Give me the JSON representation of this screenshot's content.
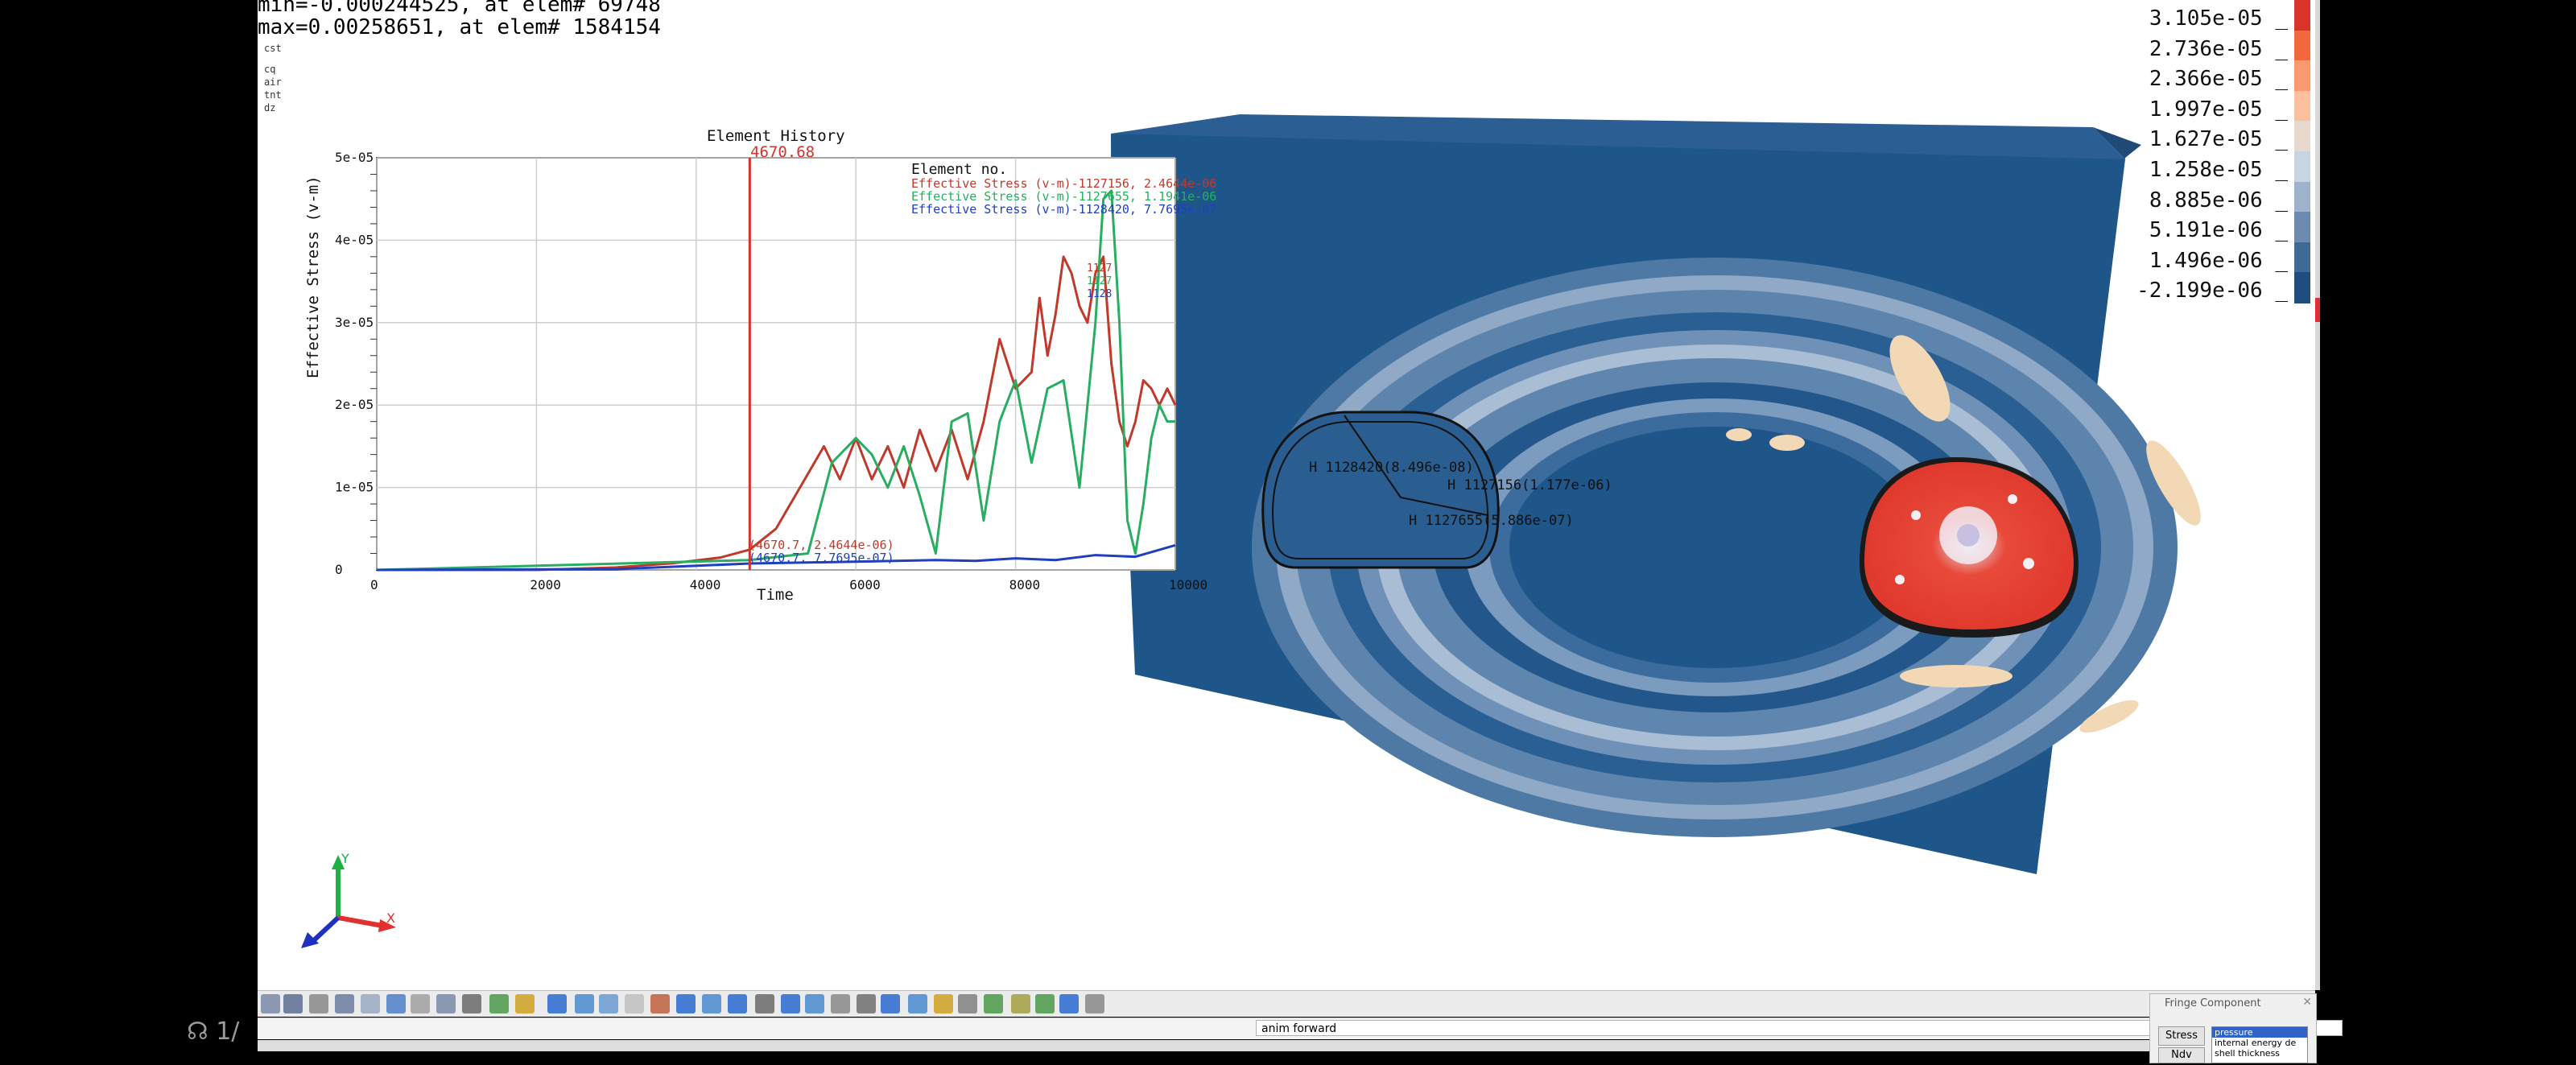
{
  "window": {
    "mode_line": "anim forward"
  },
  "overlay_text": {
    "min_line": "min=-0.000244525, at elem# 69748",
    "max_line": "max=0.00258651, at elem# 1584154",
    "side_labels": [
      "cst",
      "cq",
      "air",
      "tnt",
      "dz"
    ]
  },
  "history_plot": {
    "title": "Element History",
    "cursor_time_label": "4670.68",
    "ylabel": "Effective Stress (v-m)",
    "xlabel": "Time",
    "legend_title": "Element no.",
    "legend_entries": [
      "Effective Stress (v-m)-1127156, 2.4644e-06",
      "Effective Stress (v-m)-1127655, 1.1941e-06",
      "Effective Stress (v-m)-1128420, 7.7695e-07"
    ],
    "cursor_readout_red": "(4670.7, 2.4644e-06)",
    "cursor_readout_blue": "(4670.7, 7.7695e-07)",
    "mini_labels": [
      "1127",
      "1127",
      "1128"
    ]
  },
  "chart_data": {
    "type": "line",
    "title": "Element History",
    "xlabel": "Time",
    "ylabel": "Effective Stress (v-m)",
    "xlim": [
      0,
      10000
    ],
    "ylim": [
      0,
      5e-05
    ],
    "x_ticks": [
      "0",
      "2000",
      "4000",
      "6000",
      "8000",
      "10000"
    ],
    "y_ticks": [
      "0",
      "1e-05",
      "2e-05",
      "3e-05",
      "4e-05",
      "5e-05"
    ],
    "cursor_x": 4670.68,
    "grid": true,
    "series": [
      {
        "name": "Effective Stress (v-m)-1127156",
        "color": "#c0392b",
        "x": [
          0,
          2000,
          3000,
          3700,
          4300,
          4670,
          5000,
          5300,
          5600,
          5800,
          6000,
          6200,
          6400,
          6600,
          6800,
          7000,
          7200,
          7400,
          7600,
          7700,
          7800,
          7900,
          8000,
          8200,
          8300,
          8400,
          8500,
          8600,
          8700,
          8800,
          8900,
          9000,
          9100,
          9200,
          9300,
          9400,
          9500,
          9600,
          9700,
          9800,
          9900,
          10000
        ],
        "y": [
          0,
          0,
          3e-07,
          8e-07,
          1.5e-06,
          2.4644e-06,
          5e-06,
          1e-05,
          1.5e-05,
          1.1e-05,
          1.6e-05,
          1.1e-05,
          1.5e-05,
          1e-05,
          1.7e-05,
          1.2e-05,
          1.7e-05,
          1.1e-05,
          1.8e-05,
          2.3e-05,
          2.8e-05,
          2.5e-05,
          2.2e-05,
          2.4e-05,
          3.3e-05,
          2.6e-05,
          3.1e-05,
          3.8e-05,
          3.6e-05,
          3.2e-05,
          3e-05,
          3.6e-05,
          3.8e-05,
          2.5e-05,
          1.8e-05,
          1.5e-05,
          1.8e-05,
          2.3e-05,
          2.2e-05,
          2e-05,
          2.2e-05,
          2e-05
        ]
      },
      {
        "name": "Effective Stress (v-m)-1127655",
        "color": "#27ae60",
        "x": [
          0,
          4670,
          5400,
          5700,
          6000,
          6200,
          6400,
          6600,
          6800,
          7000,
          7200,
          7400,
          7600,
          7800,
          8000,
          8200,
          8400,
          8600,
          8800,
          9000,
          9100,
          9200,
          9300,
          9400,
          9500,
          9600,
          9700,
          9800,
          9900,
          10000
        ],
        "y": [
          0,
          1.1941e-06,
          2e-06,
          1.3e-05,
          1.6e-05,
          1.4e-05,
          1e-05,
          1.5e-05,
          9e-06,
          2e-06,
          1.8e-05,
          1.9e-05,
          6e-06,
          1.8e-05,
          2.3e-05,
          1.3e-05,
          2.2e-05,
          2.3e-05,
          1e-05,
          3e-05,
          4.5e-05,
          4.6e-05,
          3e-05,
          6e-06,
          2e-06,
          8e-06,
          1.6e-05,
          2e-05,
          1.8e-05,
          1.8e-05
        ]
      },
      {
        "name": "Effective Stress (v-m)-1128420",
        "color": "#1f3fbf",
        "x": [
          0,
          3000,
          4670,
          6000,
          7000,
          7500,
          8000,
          8500,
          9000,
          9500,
          10000
        ],
        "y": [
          0,
          1e-07,
          7.7695e-07,
          1e-06,
          1.2e-06,
          1.1e-06,
          1.4e-06,
          1.2e-06,
          1.8e-06,
          1.6e-06,
          3e-06
        ]
      }
    ]
  },
  "model_labels": [
    "H 1128420(8.496e-08)",
    "H 1127156(1.177e-06)",
    "H 1127655(5.886e-07)"
  ],
  "fringe_legend": {
    "values": [
      "3.105e-05",
      "2.736e-05",
      "2.366e-05",
      "1.997e-05",
      "1.627e-05",
      "1.258e-05",
      "8.885e-06",
      "5.191e-06",
      "1.496e-06",
      "-2.199e-06"
    ],
    "colors": [
      "#d8342c",
      "#f2693e",
      "#f99a6e",
      "#fcc19c",
      "#e8d8ce",
      "#c8d4e2",
      "#9fb3cc",
      "#6d8bb0",
      "#3f6a98",
      "#1f4d7e"
    ]
  },
  "triad": {
    "x_label": "X",
    "y_label": "Y"
  },
  "fringe_panel": {
    "title": "Fringe Component",
    "stress_button": "Stress",
    "ndv_button": "Ndv",
    "options": [
      "pressure",
      "internal energy de",
      "shell thickness"
    ]
  },
  "watermark": "1/"
}
